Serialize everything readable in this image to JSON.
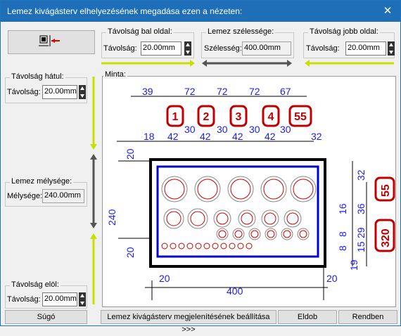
{
  "window": {
    "title": "Lemez kivágásterv elhelyezésének megadása ezen a nézeten:",
    "close_glyph": "✕"
  },
  "top_left_icon": "fit-sheet-icon",
  "left_margin": {
    "title": "Távolság bal oldal:",
    "label": "Távolság:",
    "value": "20.00mm"
  },
  "sheet_width": {
    "title": "Lemez szélessége:",
    "label": "Szélesség:",
    "value": "400.00mm"
  },
  "right_margin": {
    "title": "Távolság jobb oldal:",
    "label": "Távolság:",
    "value": "20.00mm"
  },
  "back_margin": {
    "title": "Távolság hátul:",
    "label": "Távolság:",
    "value": "20.00mm"
  },
  "sheet_depth": {
    "title": "Lemez mélysége:",
    "label": "Mélysége:",
    "value": "240.00mm"
  },
  "front_margin": {
    "title": "Távolság elöl:",
    "label": "Távolság:",
    "value": "20.00mm"
  },
  "preview": {
    "title": "Minta:",
    "top_row1": [
      "39",
      "72",
      "72",
      "72",
      "67"
    ],
    "top_row2": [
      "18",
      "30",
      "42",
      "30",
      "42",
      "30",
      "42",
      "30",
      "42",
      "30",
      "32"
    ],
    "top_row2_upper": [
      "30",
      "30",
      "30",
      "30"
    ],
    "top_row2_lower": [
      "18",
      "42",
      "42",
      "42",
      "42",
      "32"
    ],
    "tags": [
      "1",
      "2",
      "3",
      "4",
      "55"
    ],
    "right_tags": [
      "55",
      "320"
    ],
    "left_dims": [
      "20",
      "240",
      "20"
    ],
    "right_dims": [
      "32",
      "36",
      "16",
      "29",
      "15",
      "8",
      "8",
      "19"
    ],
    "bottom_dims": [
      "20",
      "400",
      "20"
    ]
  },
  "buttons": {
    "help": "Súgó",
    "settings": "Lemez kivágásterv megjelenítésének beállítása >>>",
    "discard": "Eldob",
    "ok": "Rendben"
  },
  "colors": {
    "accent_green": "#c8e000",
    "dim_blue": "#1a1aff",
    "tag_red": "#c00000"
  }
}
